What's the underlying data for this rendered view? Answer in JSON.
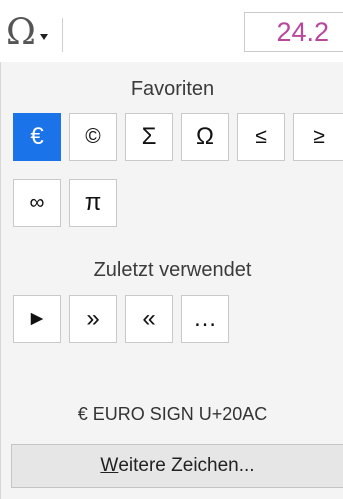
{
  "toolbar": {
    "special_char_icon": "omega-icon",
    "special_char_glyph": "Ω",
    "font_size_value": "24.2"
  },
  "favorites": {
    "heading": "Favoriten",
    "chars": [
      "€",
      "©",
      "Σ",
      "Ω",
      "≤",
      "≥",
      "∞",
      "π"
    ],
    "selected_index": 0
  },
  "recent": {
    "heading": "Zuletzt verwendet",
    "chars": [
      "►",
      "»",
      "«",
      "…"
    ]
  },
  "char_info": "€ EURO SIGN U+20AC",
  "more_button": {
    "mnemonic": "W",
    "rest": "eitere Zeichen..."
  },
  "colors": {
    "selected_bg": "#1a73e8",
    "font_size_text": "#b8479e"
  }
}
